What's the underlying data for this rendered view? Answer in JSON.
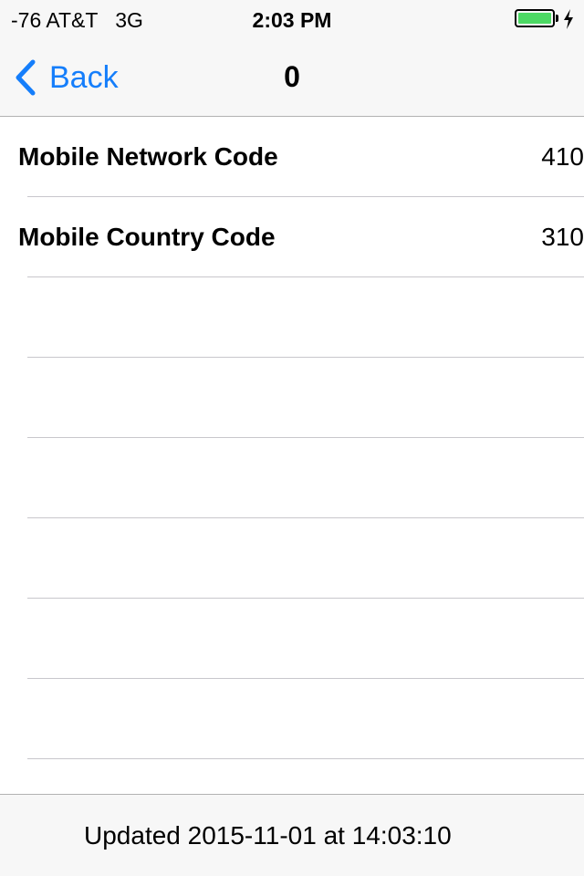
{
  "status_bar": {
    "carrier": "-76 AT&T   3G",
    "time": "2:03 PM",
    "battery_color": "#4cd964",
    "battery_level": 1.0,
    "charging_icon": "bolt-icon"
  },
  "nav": {
    "back_label": "Back",
    "back_icon": "chevron-left-icon",
    "title": "0",
    "accent_color": "#157efb"
  },
  "table": {
    "rows": [
      {
        "label": "Mobile Network Code",
        "value": "410"
      },
      {
        "label": "Mobile Country Code",
        "value": "310"
      },
      {
        "label": "",
        "value": ""
      },
      {
        "label": "",
        "value": ""
      },
      {
        "label": "",
        "value": ""
      },
      {
        "label": "",
        "value": ""
      },
      {
        "label": "",
        "value": ""
      },
      {
        "label": "",
        "value": ""
      }
    ]
  },
  "toolbar": {
    "updated_text": "Updated 2015-11-01 at 14:03:10"
  }
}
